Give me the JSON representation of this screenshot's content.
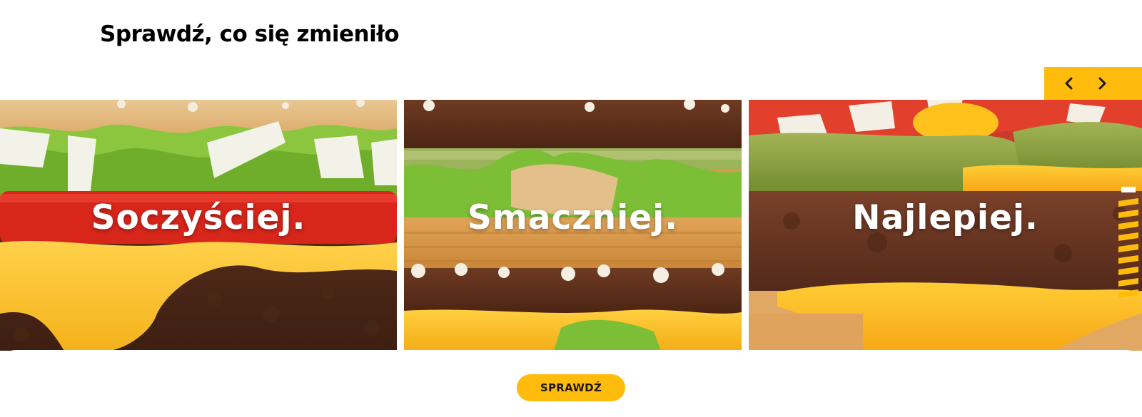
{
  "section": {
    "title": "Sprawdź, co się zmieniło"
  },
  "carousel": {
    "prev_icon": "chevron-left-icon",
    "next_icon": "chevron-right-icon",
    "accent": "#ffbc0d",
    "slides": [
      {
        "label": "Soczyściej."
      },
      {
        "label": "Smaczniej."
      },
      {
        "label": "Najlepiej."
      }
    ]
  },
  "cta": {
    "label": "SPRAWDŹ"
  }
}
